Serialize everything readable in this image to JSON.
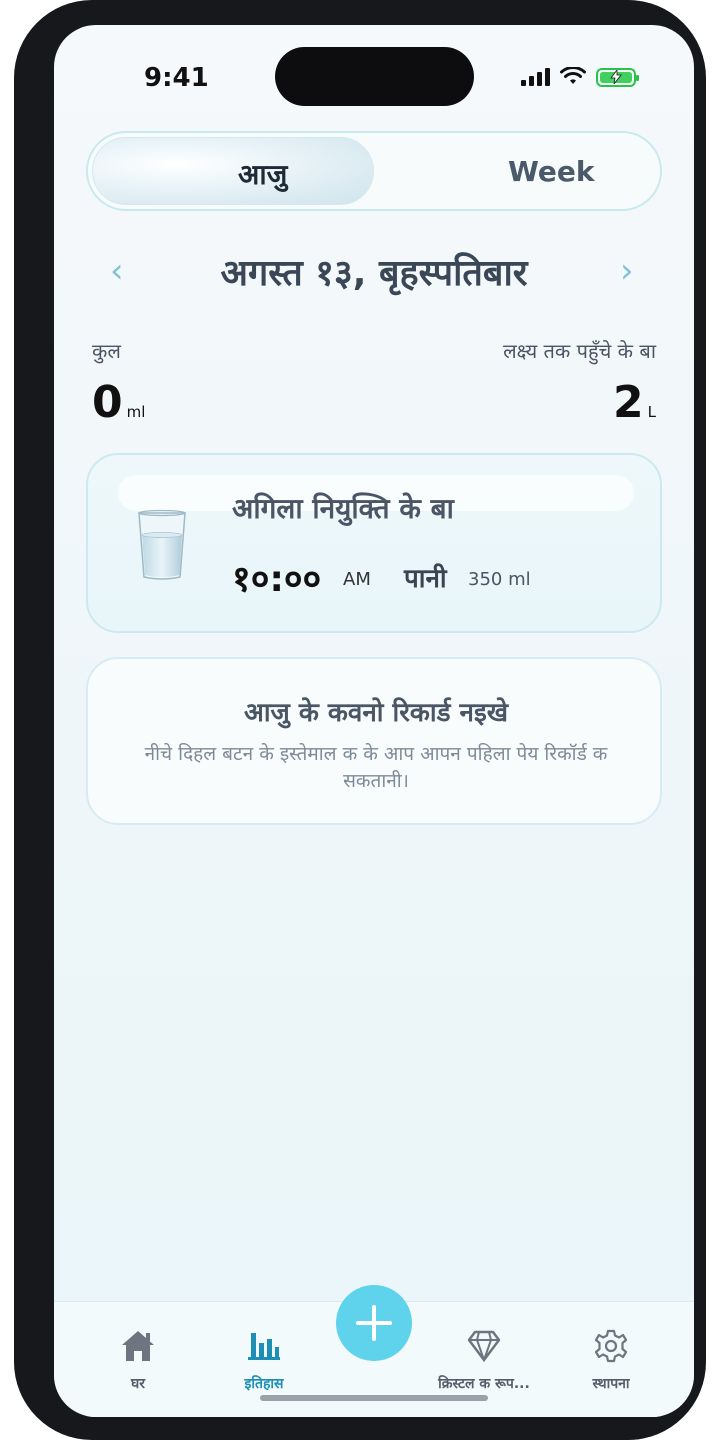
{
  "status_bar": {
    "time": "9:41"
  },
  "segment": {
    "tabs": [
      {
        "label": "आजु",
        "selected": true
      },
      {
        "label": "Week",
        "selected": false
      }
    ]
  },
  "date_nav": {
    "title": "अगस्त १३, बृहस्पतिबार",
    "prev": "‹",
    "next": "›"
  },
  "summary": {
    "total_label": "कुल",
    "total_value": "0",
    "total_unit": "ml",
    "goal_label": "लक्ष्य तक पहुँचे के बा",
    "goal_value": "2",
    "goal_unit": "L"
  },
  "next_card": {
    "title": "अगिला नियुक्ति के बा",
    "time": "१०:००",
    "ampm": "AM",
    "drink": "पानी",
    "amount": "350 ml",
    "icon": "water-glass-icon"
  },
  "empty_state": {
    "title": "आजु के कवनो रिकार्ड नइखे",
    "description": "नीचे दिहल बटन के इस्तेमाल क के आप आपन पहिला पेय रिकॉर्ड क सकतानी।"
  },
  "tab_bar": {
    "items": [
      {
        "label": "घर",
        "icon": "home-icon",
        "active": false
      },
      {
        "label": "इतिहास",
        "icon": "bar-chart-icon",
        "active": true
      },
      {
        "label": "क्रिस्टल क रूप...",
        "icon": "diamond-icon",
        "active": false
      },
      {
        "label": "स्थापना",
        "icon": "gear-icon",
        "active": false
      }
    ],
    "fab_icon": "plus-icon"
  },
  "colors": {
    "accent": "#5fd3ec",
    "active_tab": "#1d8fb4",
    "battery": "#3fd05d"
  }
}
